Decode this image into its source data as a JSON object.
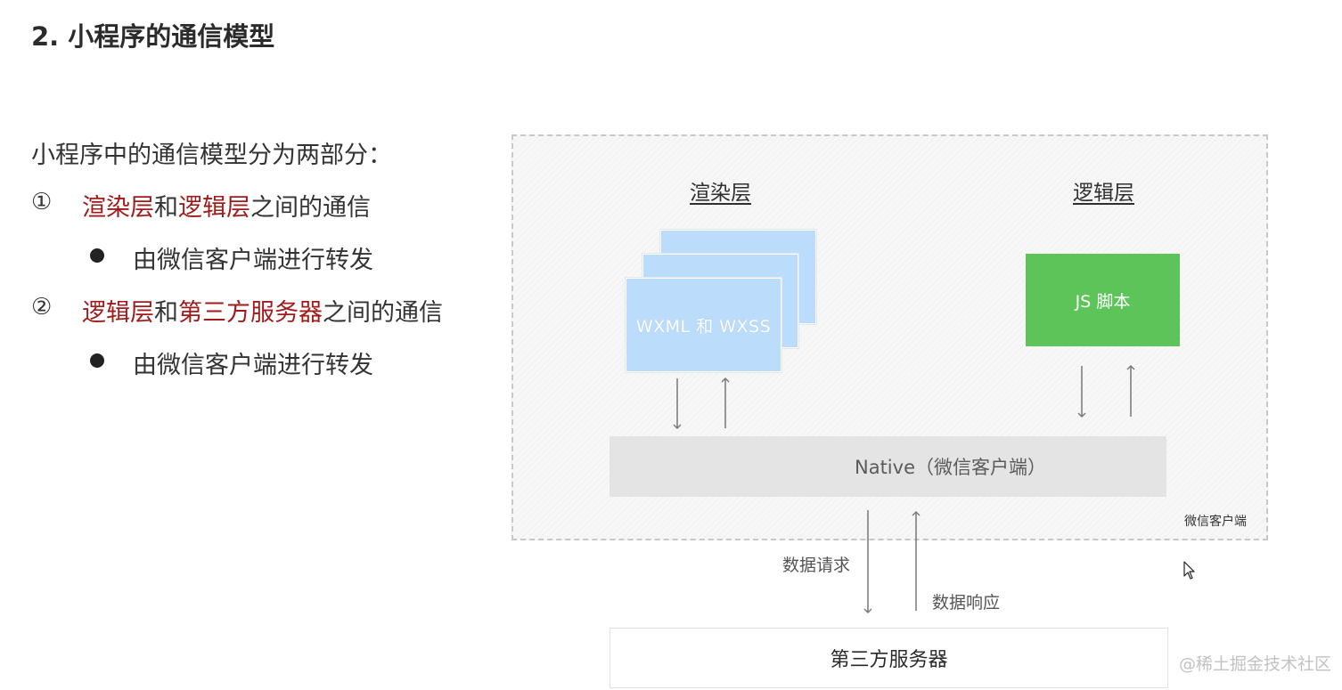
{
  "slide": {
    "title": "2. 小程序的通信模型",
    "intro": "小程序中的通信模型分为两部分：",
    "items": [
      {
        "number": "①",
        "highlight_a": "渲染层",
        "joiner": "和",
        "highlight_b": "逻辑层",
        "suffix": "之间的通信",
        "sub": "由微信客户端进行转发"
      },
      {
        "number": "②",
        "highlight_a": "逻辑层",
        "joiner": "和",
        "highlight_b": "第三方服务器",
        "suffix": "之间的通信",
        "sub": "由微信客户端进行转发"
      }
    ]
  },
  "diagram": {
    "render_layer_title": "渲染层",
    "logic_layer_title": "逻辑层",
    "view_card_label": "WXML 和 WXSS",
    "js_box_label": "JS 脚本",
    "native_label": "Native（微信客户端）",
    "client_label": "微信客户端",
    "request_label": "数据请求",
    "response_label": "数据响应",
    "server_label": "第三方服务器"
  },
  "watermark": "@稀土掘金技术社区",
  "colors": {
    "highlight": "#a01b1b",
    "view_card": "#bcdcfc",
    "js_box": "#5dc45a",
    "native_bar": "#e4e4e4"
  }
}
